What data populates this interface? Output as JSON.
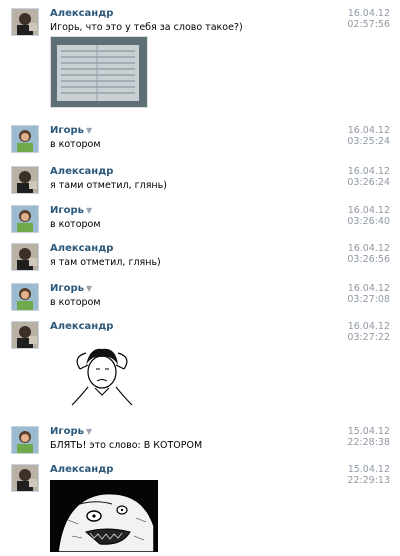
{
  "messages": [
    {
      "author": "Александр",
      "text": "Игорь, что это у тебя за слово такое?)",
      "date": "16.04.12",
      "time": "02:57:56",
      "avatar": "alexander-avatar"
    },
    {
      "author": "Игорь",
      "text": "в котором",
      "date": "16.04.12",
      "time": "03:25:24",
      "avatar": "igor-avatar"
    },
    {
      "author": "Александр",
      "text": "я тами отметил, глянь)",
      "date": "16.04.12",
      "time": "03:26:24",
      "avatar": "alexander-avatar"
    },
    {
      "author": "Игорь",
      "text": "в котором",
      "date": "16.04.12",
      "time": "03:26:40",
      "avatar": "igor-avatar"
    },
    {
      "author": "Александр",
      "text": "я там отметил, глянь)",
      "date": "16.04.12",
      "time": "03:26:56",
      "avatar": "alexander-avatar"
    },
    {
      "author": "Игорь",
      "text": "в котором",
      "date": "16.04.12",
      "time": "03:27:08",
      "avatar": "igor-avatar"
    },
    {
      "author": "Александр",
      "text": "",
      "date": "16.04.12",
      "time": "03:27:22",
      "avatar": "alexander-avatar"
    },
    {
      "author": "Игорь",
      "text": "БЛЯТЬ! это слово: В КОТОРОМ",
      "date": "15.04.12",
      "time": "22:28:38",
      "avatar": "igor-avatar"
    },
    {
      "author": "Александр",
      "text": "",
      "date": "15.04.12",
      "time": "22:29:13",
      "avatar": "alexander-avatar"
    }
  ],
  "arrow_glyph": "▼",
  "colors": {
    "name": "#2b587a",
    "date": "#8f99a5"
  }
}
